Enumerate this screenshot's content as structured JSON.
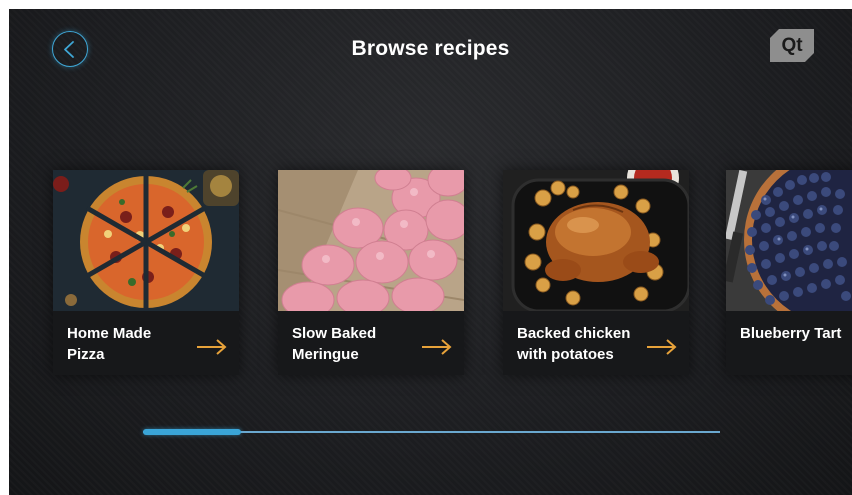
{
  "header": {
    "title": "Browse recipes",
    "logo_text": "Qt",
    "back_icon": "chevron-left-icon"
  },
  "recipes": [
    {
      "name_line1": "Home Made",
      "name_line2": "Pizza",
      "image": "pizza"
    },
    {
      "name_line1": "Slow Baked",
      "name_line2": "Meringue",
      "image": "meringue"
    },
    {
      "name_line1": "Backed chicken",
      "name_line2": "with potatoes",
      "image": "roast-chicken"
    },
    {
      "name_line1": "Blueberry Tart",
      "name_line2": "",
      "image": "blueberry-tart"
    }
  ],
  "carousel": {
    "scroll_progress": 0.17
  },
  "colors": {
    "accent_blue": "#3aa5d8",
    "arrow_orange": "#e7a23a",
    "background": "#1c1d20"
  }
}
